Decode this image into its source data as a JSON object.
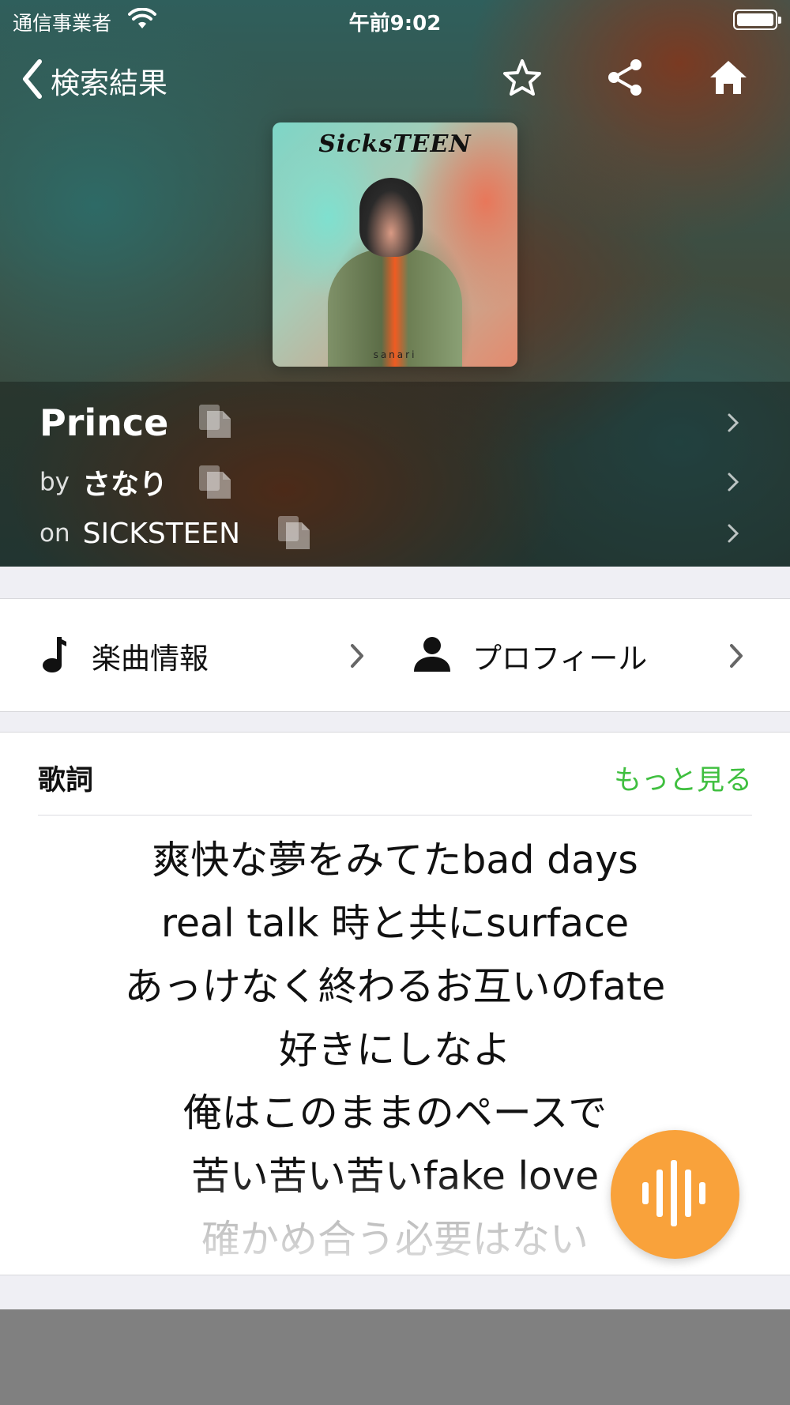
{
  "status_bar": {
    "carrier": "通信事業者",
    "time": "午前9:02"
  },
  "nav": {
    "back_label": "検索結果",
    "icons": [
      "star-outline-icon",
      "share-icon",
      "home-icon"
    ]
  },
  "album_art": {
    "logo_text": "SicksTEEN",
    "footer_text": "sanari"
  },
  "track": {
    "title": "Prince",
    "artist_prefix": "by",
    "artist": "さなり",
    "album_prefix": "on",
    "album": "SICKSTEEN"
  },
  "links": {
    "song_info_label": "楽曲情報",
    "profile_label": "プロフィール"
  },
  "lyrics": {
    "title": "歌詞",
    "more_label": "もっと見る",
    "lines": [
      "爽快な夢をみてたbad days",
      "real talk 時と共にsurface",
      "あっけなく終わるお互いのfate",
      "好きにしなよ",
      "俺はこのままのペースで",
      "苦い苦い苦いfake love",
      "確かめ合う必要はない"
    ]
  },
  "colors": {
    "accent_green": "#3fbf3f",
    "fab_orange": "#f9a23b"
  }
}
